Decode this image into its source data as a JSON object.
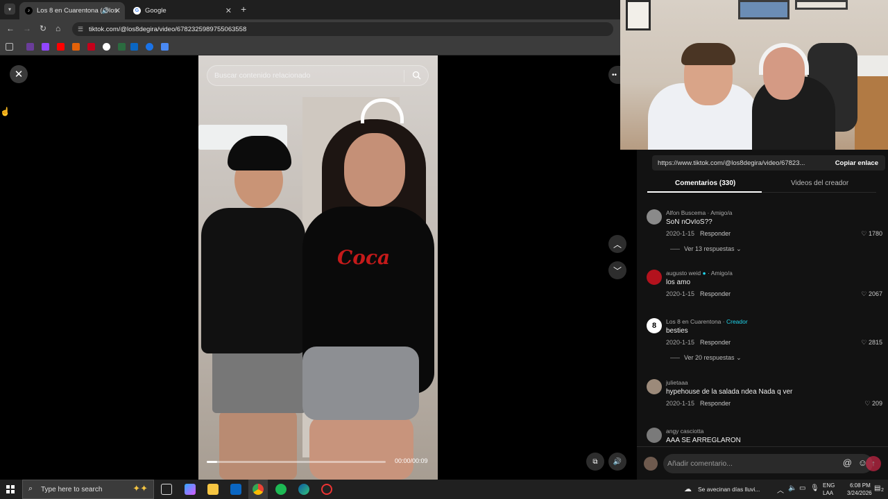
{
  "browser": {
    "tabs": [
      {
        "title": "Los 8 en Cuarentona (@los",
        "active": true
      },
      {
        "title": "Google",
        "active": false
      }
    ],
    "new_tab_label": "+",
    "url": "tiktok.com/@los8degira/video/6782325989755063558"
  },
  "player": {
    "search_placeholder": "Buscar contenido relacionado",
    "time": "00:00/00:09",
    "progress": 0.06,
    "video_overlay_logo": "Coca"
  },
  "panel": {
    "link_url": "https://www.tiktok.com/@los8degira/video/67823...",
    "copy_label": "Copiar enlace",
    "tabs": [
      {
        "label": "Comentarios (330)",
        "active": true
      },
      {
        "label": "Videos del creador",
        "active": false
      }
    ],
    "comments": [
      {
        "user": "Alfon Buscema",
        "tag": "Amigo/a",
        "text": "SoN nOvIoS??",
        "date": "2020-1-15",
        "reply": "Responder",
        "likes": "1780",
        "more": "Ver 13 respuestas",
        "avatar_color": "#8a8a8a"
      },
      {
        "user": "augusto weid",
        "tag": "Amigo/a",
        "verified": true,
        "text": "los amo",
        "date": "2020-1-15",
        "reply": "Responder",
        "likes": "2067",
        "more": "",
        "avatar_color": "#b3121d"
      },
      {
        "user": "Los 8 en Cuarentona",
        "tag": "Creador",
        "text": "besties",
        "date": "2020-1-15",
        "reply": "Responder",
        "likes": "2815",
        "more": "Ver 20 respuestas",
        "avatar_color": "#ffffff",
        "avatar_text": "8"
      },
      {
        "user": "julietaaa",
        "tag": "",
        "text": "hypehouse de la salada ndea Nada q ver",
        "date": "2020-1-15",
        "reply": "Responder",
        "likes": "209",
        "more": "",
        "avatar_color": "#9c8a7a"
      },
      {
        "user": "angy casciotta",
        "tag": "",
        "text": "AAA SE ARREGLARON",
        "date": "",
        "reply": "",
        "likes": "",
        "more": "",
        "avatar_color": "#7a7a7a"
      }
    ],
    "comment_placeholder": "Añadir comentario..."
  },
  "taskbar": {
    "search_placeholder": "Type here to search",
    "weather": "Se avecinan días lluvi...",
    "lang": "ENG",
    "layout": "LAA",
    "time": "6:08 PM",
    "date": "3/24/2026",
    "notifications": "2"
  },
  "colors": {
    "accent_creator": "#20d5ec",
    "tiktok_red": "#fe2c55"
  }
}
